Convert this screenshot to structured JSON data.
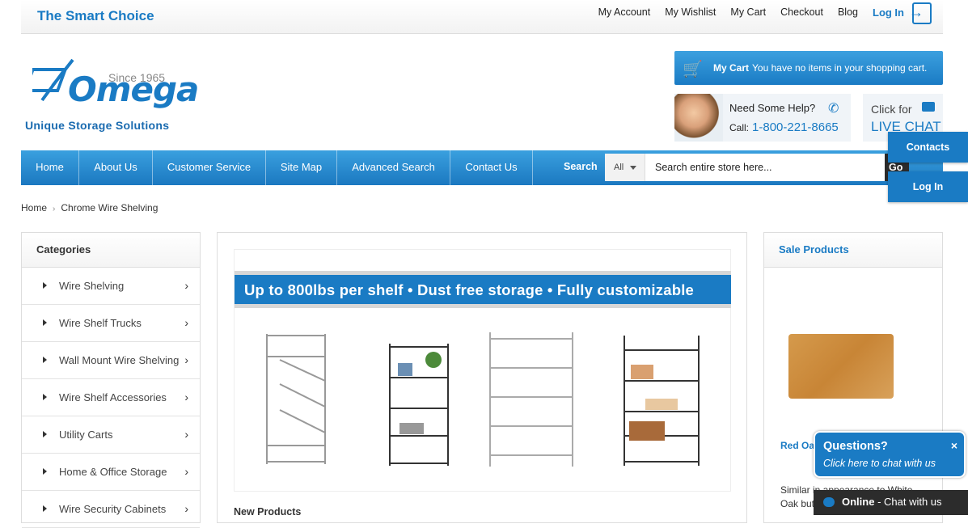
{
  "topbar": {
    "tagline": "The Smart Choice",
    "links": [
      "My Account",
      "My Wishlist",
      "My Cart",
      "Checkout",
      "Blog"
    ],
    "login": "Log In"
  },
  "logo": {
    "name": "Omega",
    "since": "Since 1965",
    "subtitle": "Unique Storage Solutions"
  },
  "cart": {
    "label": "My Cart",
    "message": "You have no items in your shopping cart."
  },
  "help": {
    "title": "Need Some Help?",
    "call_label": "Call:",
    "phone": "1-800-221-8665"
  },
  "livechat": {
    "line1": "Click for",
    "line2": "LIVE CHAT"
  },
  "nav": {
    "items": [
      "Home",
      "About Us",
      "Customer Service",
      "Site Map",
      "Advanced Search",
      "Contact Us"
    ],
    "search_label": "Search",
    "search_scope": "All",
    "search_placeholder": "Search entire store here...",
    "go": "Go"
  },
  "side_tabs": [
    "Contacts",
    "Log In"
  ],
  "breadcrumb": [
    "Home",
    "Chrome Wire Shelving"
  ],
  "categories": {
    "title": "Categories",
    "items": [
      "Wire Shelving",
      "Wire Shelf Trucks",
      "Wall Mount Wire Shelving",
      "Wire Shelf Accessories",
      "Utility Carts",
      "Home & Office Storage",
      "Wire Security Cabinets"
    ]
  },
  "main": {
    "banner": "Up to 800lbs per shelf • Dust free storage • Fully customizable",
    "new_products": "New Products"
  },
  "sale": {
    "title": "Sale Products",
    "product_name": "Red Oa",
    "product_desc": "Similar in appearance to White Oak but"
  },
  "chat_widget": {
    "title": "Questions?",
    "subtitle": "Click here to chat with us",
    "close": "×",
    "status_bold": "Online",
    "status_rest": " - Chat with us"
  },
  "colors": {
    "brand_blue": "#1a7bc4",
    "dark": "#2c2c2c"
  }
}
